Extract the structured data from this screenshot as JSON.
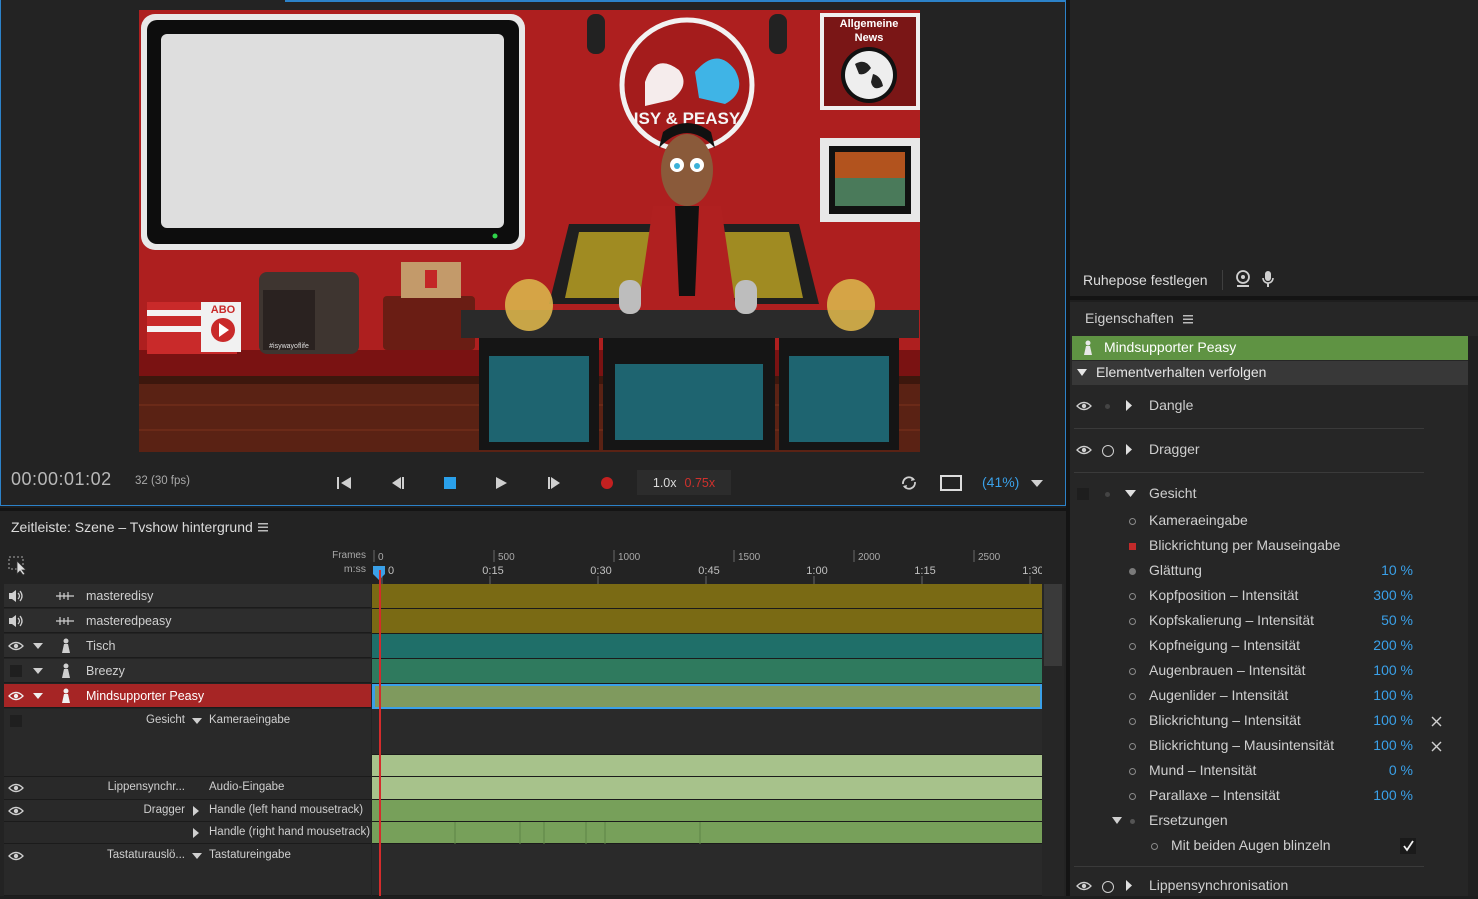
{
  "scene": {
    "news_line1": "Allgemeine",
    "news_line2": "News",
    "logo_text": "ISY & PEASY",
    "abo_text": "ABO",
    "tag_text": "#isywayoflife"
  },
  "transport": {
    "timecode": "00:00:01:02",
    "frames": "32 (30 fps)",
    "speed": "1.0x",
    "speed_alt": "0.75x",
    "zoom": "(41%)"
  },
  "right_top": {
    "rest_pose": "Ruhepose festlegen"
  },
  "timeline": {
    "title": "Zeitleiste: Szene – Tvshow hintergrund",
    "ruler_frames_label": "Frames",
    "ruler_time_label": "m:ss",
    "frame_ticks": [
      "0",
      "500",
      "1000",
      "1500",
      "2000",
      "2500"
    ],
    "time_ticks": [
      "0",
      "0:15",
      "0:30",
      "0:45",
      "1:00",
      "1:15",
      "1:30"
    ],
    "tracks": [
      {
        "name": "masteredisy"
      },
      {
        "name": "masteredpeasy"
      },
      {
        "name": "Tisch"
      },
      {
        "name": "Breezy"
      },
      {
        "name": "Mindsupporter Peasy"
      }
    ],
    "subtracks": [
      {
        "behavior": "Gesicht",
        "param": "Kameraeingabe"
      },
      {
        "behavior": "Lippensynchr...",
        "param": "Audio-Eingabe"
      },
      {
        "behavior": "Dragger",
        "param": "Handle (left hand mousetrack)"
      },
      {
        "behavior": "",
        "param": "Handle (right hand mousetrack)"
      },
      {
        "behavior": "Tastaturauslö...",
        "param": "Tastatureingabe"
      }
    ]
  },
  "properties": {
    "title": "Eigenschaften",
    "puppet": "Mindsupporter Peasy",
    "section": "Elementverhalten verfolgen",
    "behaviors": [
      "Dangle",
      "Dragger",
      "Gesicht",
      "Lippensynchronisation"
    ],
    "face_params": [
      {
        "label": "Kameraeingabe",
        "value": ""
      },
      {
        "label": "Blickrichtung per Mauseingabe",
        "value": ""
      },
      {
        "label": "Glättung",
        "value": "10 %"
      },
      {
        "label": "Kopfposition – Intensität",
        "value": "300 %"
      },
      {
        "label": "Kopfskalierung – Intensität",
        "value": "50 %"
      },
      {
        "label": "Kopfneigung – Intensität",
        "value": "200 %"
      },
      {
        "label": "Augenbrauen – Intensität",
        "value": "100 %"
      },
      {
        "label": "Augenlider – Intensität",
        "value": "100 %"
      },
      {
        "label": "Blickrichtung – Intensität",
        "value": "100 %"
      },
      {
        "label": "Blickrichtung – Mausintensität",
        "value": "100 %"
      },
      {
        "label": "Mund – Intensität",
        "value": "0 %"
      },
      {
        "label": "Parallaxe – Intensität",
        "value": "100 %"
      }
    ],
    "replacements": "Ersetzungen",
    "blink": "Mit beiden Augen blinzeln"
  },
  "colors": {
    "accent": "#2c82c9",
    "selected_track": "#a62525",
    "puppet_header": "#5f9343",
    "value_blue": "#3aa0e8",
    "audio_lane": "#7a6a14",
    "teal_lane": "#1f6f69"
  }
}
